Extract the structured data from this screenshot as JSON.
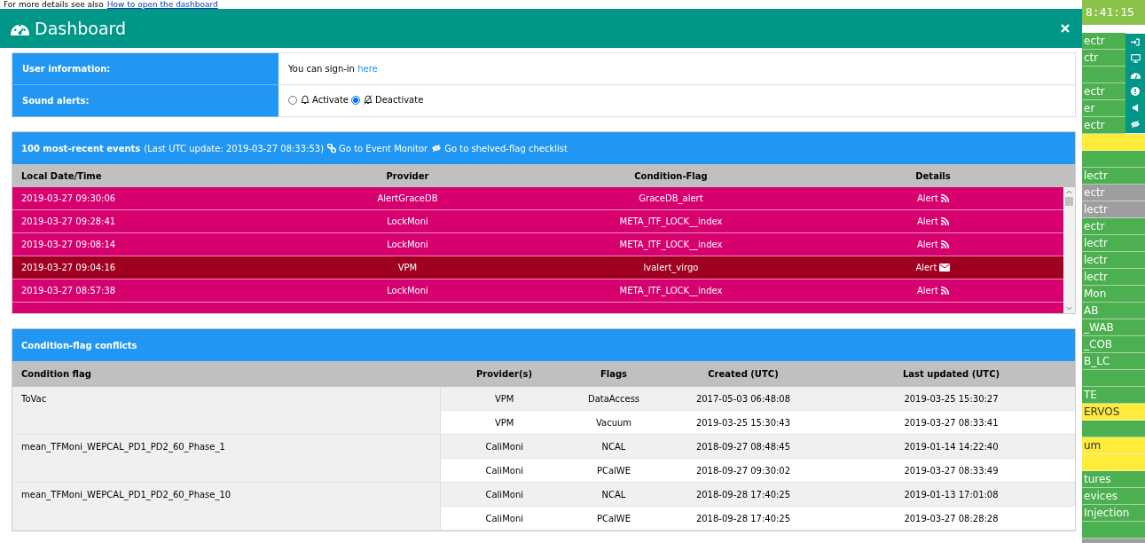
{
  "top_note": {
    "text": "For more details see also",
    "link": "How to open the dashboard"
  },
  "dialog": {
    "title": "Dashboard",
    "info_rows": [
      {
        "label": "User information:",
        "kind": "signin",
        "text": "You can sign-in",
        "link": "here"
      },
      {
        "label": "Sound alerts:",
        "kind": "radios",
        "options": [
          {
            "label": "Activate",
            "selected": false
          },
          {
            "label": "Deactivate",
            "selected": true
          }
        ]
      }
    ],
    "events": {
      "title": "100 most-recent events",
      "update": "(Last UTC update: 2019-03-27 08:33:53)",
      "links": [
        {
          "label": "Go to Event Monitor"
        },
        {
          "label": "Go to shelved-flag checklist"
        }
      ],
      "columns": [
        "Local Date/Time",
        "Provider",
        "Condition-Flag",
        "Details"
      ],
      "rows": [
        {
          "time": "2019-03-27 09:30:06",
          "provider": "AlertGraceDB",
          "flag": "GraceDB_alert",
          "details": "Alert",
          "kind": "rss",
          "color": "#d6006f"
        },
        {
          "time": "2019-03-27 09:28:41",
          "provider": "LockMoni",
          "flag": "META_ITF_LOCK__index",
          "details": "Alert",
          "kind": "rss",
          "color": "#d6006f"
        },
        {
          "time": "2019-03-27 09:08:14",
          "provider": "LockMoni",
          "flag": "META_ITF_LOCK__index",
          "details": "Alert",
          "kind": "rss",
          "color": "#d6006f"
        },
        {
          "time": "2019-03-27 09:04:16",
          "provider": "VPM",
          "flag": "lvalert_virgo",
          "details": "Alert",
          "kind": "mail",
          "color": "#a00020"
        },
        {
          "time": "2019-03-27 08:57:38",
          "provider": "LockMoni",
          "flag": "META_ITF_LOCK__index",
          "details": "Alert",
          "kind": "rss",
          "color": "#d6006f"
        }
      ]
    },
    "conflicts": {
      "title": "Condition-flag conflicts",
      "columns": [
        "Condition flag",
        "Provider(s)",
        "Flags",
        "Created (UTC)",
        "Last updated (UTC)"
      ],
      "groups": [
        {
          "flag": "ToVac",
          "entries": [
            {
              "provider": "VPM",
              "flags": "DataAccess",
              "created": "2017-05-03 06:48:08",
              "updated": "2019-03-25 15:30:27"
            },
            {
              "provider": "VPM",
              "flags": "Vacuum",
              "created": "2019-03-25 15:30:43",
              "updated": "2019-03-27 08:33:41"
            }
          ]
        },
        {
          "flag": "mean_TFMoni_WEPCAL_PD1_PD2_60_Phase_1",
          "entries": [
            {
              "provider": "CaliMoni",
              "flags": "NCAL",
              "created": "2018-09-27 08:48:45",
              "updated": "2019-01-14 14:22:40"
            },
            {
              "provider": "CaliMoni",
              "flags": "PCalWE",
              "created": "2018-09-27 09:30:02",
              "updated": "2019-03-27 08:33:49"
            }
          ]
        },
        {
          "flag": "mean_TFMoni_WEPCAL_PD1_PD2_60_Phase_10",
          "entries": [
            {
              "provider": "CaliMoni",
              "flags": "NCAL",
              "created": "2018-09-28 17:40:25",
              "updated": "2019-01-13 17:01:08"
            },
            {
              "provider": "CaliMoni",
              "flags": "PCalWE",
              "created": "2018-09-28 17:40:25",
              "updated": "2019-03-27 08:28:28"
            }
          ]
        }
      ]
    }
  },
  "sidebar": {
    "clock": "8:41:15",
    "items": [
      {
        "text": "ectr",
        "color": "#4caf50"
      },
      {
        "text": "ctr",
        "color": "#4caf50"
      },
      {
        "color": "#4caf50"
      },
      {
        "text": "ectr",
        "color": "#4caf50"
      },
      {
        "text": "er",
        "color": "#4caf50"
      },
      {
        "text": "ectr",
        "color": "#4caf50"
      },
      {
        "color": "#ffeb3b"
      },
      {
        "color": "#4caf50"
      },
      {
        "text": "lectr",
        "color": "#4caf50"
      },
      {
        "text": "ectr",
        "color": "#9e9e9e"
      },
      {
        "text": "lectr",
        "color": "#9e9e9e"
      },
      {
        "text": "ectr",
        "color": "#4caf50"
      },
      {
        "text": "lectr",
        "color": "#4caf50"
      },
      {
        "text": "lectr",
        "color": "#4caf50"
      },
      {
        "text": "lectr",
        "color": "#4caf50"
      },
      {
        "text": "Mon",
        "color": "#4caf50"
      },
      {
        "text": "AB",
        "color": "#4caf50"
      },
      {
        "text": "_WAB",
        "color": "#4caf50"
      },
      {
        "text": "_COB",
        "color": "#4caf50"
      },
      {
        "text": "B_LC",
        "color": "#4caf50"
      },
      {
        "color": "#4caf50"
      },
      {
        "text": "TE",
        "color": "#4caf50"
      },
      {
        "text": "ERVOS",
        "color": "#ffeb3b"
      },
      {
        "color": "#4caf50"
      },
      {
        "text": "um",
        "color": "#ffeb3b"
      },
      {
        "color": "#ffeb3b"
      },
      {
        "text": "tures",
        "color": "#4caf50"
      },
      {
        "text": "evices",
        "color": "#4caf50"
      },
      {
        "text": "Injection",
        "color": "#4caf50"
      },
      {
        "color": "#4caf50"
      },
      {
        "color": "#9e9e9e"
      }
    ],
    "tools": [
      {
        "kind": "sign-in"
      },
      {
        "kind": "monitor"
      },
      {
        "kind": "gauge"
      },
      {
        "kind": "alert"
      },
      {
        "kind": "volume"
      },
      {
        "kind": "eye-slash"
      }
    ]
  }
}
